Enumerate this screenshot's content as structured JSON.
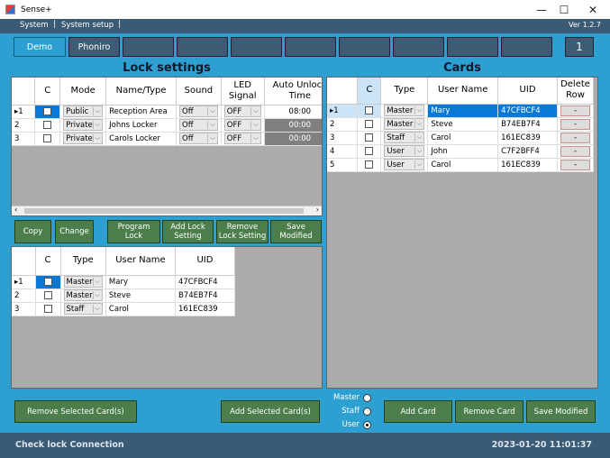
{
  "window": {
    "title": "Sense+",
    "minimize": "—",
    "maximize": "☐",
    "close": "✕"
  },
  "menu": {
    "items": [
      "System",
      "System setup"
    ],
    "version": "Ver 1.2.7"
  },
  "tabs": {
    "items": [
      "Demo",
      "Phoniro",
      "",
      "",
      "",
      "",
      "",
      "",
      "",
      ""
    ],
    "selected": 0,
    "page": "1"
  },
  "lock_settings": {
    "title": "Lock settings",
    "columns": [
      "C",
      "Mode",
      "Name/Type",
      "Sound",
      "LED Signal",
      "Auto Unlock Time"
    ],
    "rows": [
      {
        "num": "1",
        "mode": "Public",
        "name": "Reception Area",
        "sound": "Off",
        "led": "OFF",
        "time": "08:00"
      },
      {
        "num": "2",
        "mode": "Private",
        "name": "Johns Locker",
        "sound": "Off",
        "led": "OFF",
        "time": "00:00"
      },
      {
        "num": "3",
        "mode": "Private",
        "name": "Carols Locker",
        "sound": "Off",
        "led": "OFF",
        "time": "00:00"
      }
    ],
    "buttons": {
      "copy": "Copy",
      "change": "Change",
      "program": "Program Lock",
      "add": "Add Lock Setting",
      "remove": "Remove Lock Setting",
      "save": "Save Modified"
    }
  },
  "lock_cards": {
    "columns": [
      "C",
      "Type",
      "User Name",
      "UID"
    ],
    "rows": [
      {
        "num": "1",
        "type": "Master",
        "user": "Mary",
        "uid": "47CFBCF4"
      },
      {
        "num": "2",
        "type": "Master",
        "user": "Steve",
        "uid": "B74EB7F4"
      },
      {
        "num": "3",
        "type": "Staff",
        "user": "Carol",
        "uid": "161EC839"
      }
    ]
  },
  "cards": {
    "title": "Cards",
    "columns": [
      "C",
      "Type",
      "User Name",
      "UID",
      "Delete Row"
    ],
    "rows": [
      {
        "num": "1",
        "type": "Master",
        "user": "Mary",
        "uid": "47CFBCF4",
        "del": "-"
      },
      {
        "num": "2",
        "type": "Master",
        "user": "Steve",
        "uid": "B74EB7F4",
        "del": "-"
      },
      {
        "num": "3",
        "type": "Staff",
        "user": "Carol",
        "uid": "161EC839",
        "del": "-"
      },
      {
        "num": "4",
        "type": "User",
        "user": "John",
        "uid": "C7F2BFF4",
        "del": "-"
      },
      {
        "num": "5",
        "type": "User",
        "user": "Carol",
        "uid": "161EC839",
        "del": "-"
      }
    ]
  },
  "bottom": {
    "remove_selected": "Remove Selected Card(s)",
    "add_selected": "Add Selected Card(s)",
    "radios": [
      "Master",
      "Staff",
      "User"
    ],
    "radio_selected": "User",
    "add_card": "Add Card",
    "remove_card": "Remove Card",
    "save_modified": "Save Modified"
  },
  "status": {
    "message": "Check lock Connection",
    "datetime": "2023-01-20 11:01:37"
  },
  "colors": {
    "accent": "#2e9fd1",
    "dark": "#3b5a73",
    "button_green": "#4c7e4c",
    "selection": "#0a78d7"
  }
}
